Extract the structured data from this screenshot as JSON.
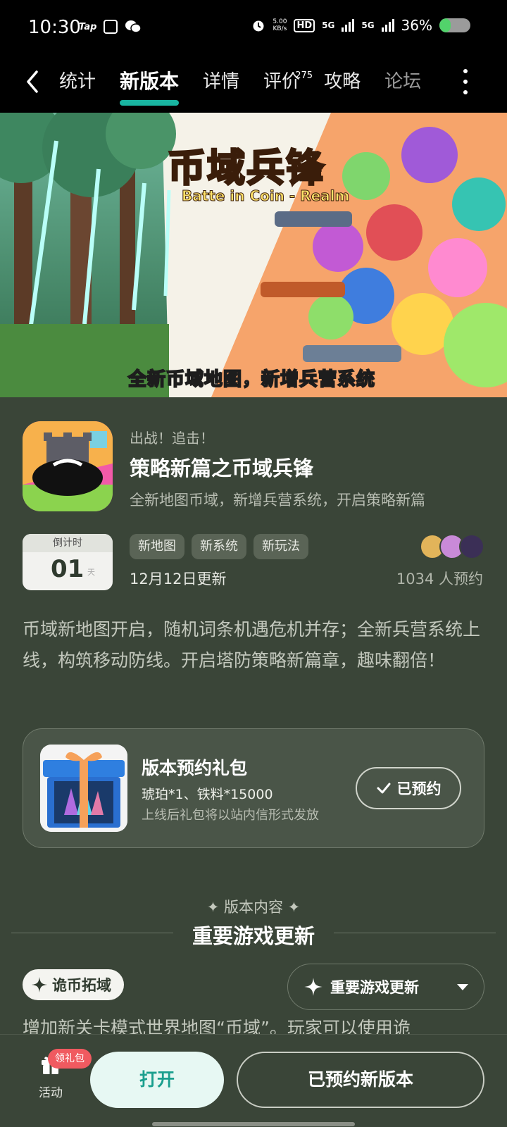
{
  "status_bar": {
    "time": "10:30",
    "tap_label": "Tap",
    "net_speed_value": "5.00",
    "net_speed_unit": "KB/s",
    "hd_label": "HD",
    "signal_1": "5G",
    "signal_2": "5G",
    "battery_text": "36%",
    "battery_level": 0.36
  },
  "nav": {
    "tabs": [
      {
        "label": "统计"
      },
      {
        "label": "新版本",
        "active": true
      },
      {
        "label": "详情"
      },
      {
        "label": "评价",
        "badge": "275"
      },
      {
        "label": "攻略"
      },
      {
        "label": "论坛"
      }
    ]
  },
  "banner": {
    "title": "币域兵锋",
    "subtitle": "Batte in Coin - Realm",
    "caption": "全新币域地图，新增兵营系统"
  },
  "version": {
    "tag": "出战！追击！",
    "title": "策略新篇之币域兵锋",
    "description": "全新地图币域，新增兵营系统，开启策略新篇",
    "countdown_label": "倒计时",
    "countdown_value": "01",
    "countdown_unit": "天",
    "chips": [
      "新地图",
      "新系统",
      "新玩法"
    ],
    "update_date": "12月12日更新",
    "reserve_count": "1034 人预约",
    "intro": "币域新地图开启，随机词条机遇危机并存；全新兵营系统上线，构筑移动防线。开启塔防策略新篇章，趣味翻倍！"
  },
  "gift": {
    "title": "版本预约礼包",
    "items": "琥珀*1、铁料*15000",
    "note": "上线后礼包将以站内信形式发放",
    "button": "已预约"
  },
  "section": {
    "small_title": "✦ 版本内容 ✦",
    "big_title": "重要游戏更新",
    "pill": "诡币拓域",
    "dropdown": "重要游戏更新",
    "content_line": "增加新关卡模式世界地图“币域”。玩家可以使用诡"
  },
  "bottom": {
    "activity_label": "活动",
    "activity_badge": "领礼包",
    "open_button": "打开",
    "reserved_button": "已预约新版本"
  },
  "colors": {
    "background": "#3a4538",
    "accent": "#19b5a1",
    "badge_red": "#f05a60"
  }
}
